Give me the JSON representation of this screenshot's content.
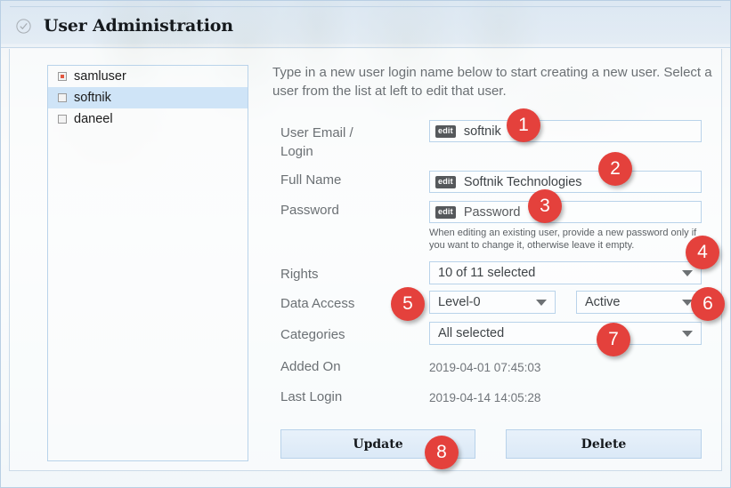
{
  "window": {
    "title": "User Administration",
    "title_icon": "check-circle-icon",
    "accent_color": "#e4413c",
    "border_color": "#b9cfe4",
    "field_border_color": "#b9d3ea",
    "selection_color": "#cfe4f7"
  },
  "user_list": {
    "items": [
      {
        "label": "samluser",
        "marker": "filled-square-icon",
        "selected": false
      },
      {
        "label": "softnik",
        "marker": "empty-square-icon",
        "selected": true
      },
      {
        "label": "daneel",
        "marker": "empty-square-icon",
        "selected": false
      }
    ]
  },
  "form": {
    "intro": "Type in a new user login name below to start creating a new user. Select a user from the list at left to edit that user.",
    "fields": {
      "email": {
        "label": "User Email /\nLogin",
        "badge": "edit",
        "value": "softnik",
        "placeholder": "softnik"
      },
      "full_name": {
        "label": "Full Name",
        "badge": "edit",
        "value": "Softnik Technologies",
        "placeholder": "Full Name"
      },
      "password": {
        "label": "Password",
        "badge": "edit",
        "value": "",
        "placeholder": "Password",
        "hint": "When editing an existing user, provide a new password only if you want to change it, otherwise leave it empty."
      },
      "rights": {
        "label": "Rights",
        "value": "10 of 11 selected"
      },
      "data_access": {
        "label": "Data Access",
        "value": "Level-0"
      },
      "status": {
        "label": "",
        "value": "Active"
      },
      "categories": {
        "label": "Categories",
        "value": "All selected"
      },
      "added_on": {
        "label": "Added On",
        "value": "2019-04-01 07:45:03"
      },
      "last_login": {
        "label": "Last Login",
        "value": "2019-04-14 14:05:28"
      }
    },
    "buttons": {
      "update": "Update",
      "delete": "Delete"
    }
  },
  "callouts": [
    {
      "number": "1",
      "target": "email-field"
    },
    {
      "number": "2",
      "target": "full-name-field"
    },
    {
      "number": "3",
      "target": "password-field"
    },
    {
      "number": "4",
      "target": "rights-select"
    },
    {
      "number": "5",
      "target": "data-access-select"
    },
    {
      "number": "6",
      "target": "status-select"
    },
    {
      "number": "7",
      "target": "categories-select"
    },
    {
      "number": "8",
      "target": "update-button"
    }
  ]
}
